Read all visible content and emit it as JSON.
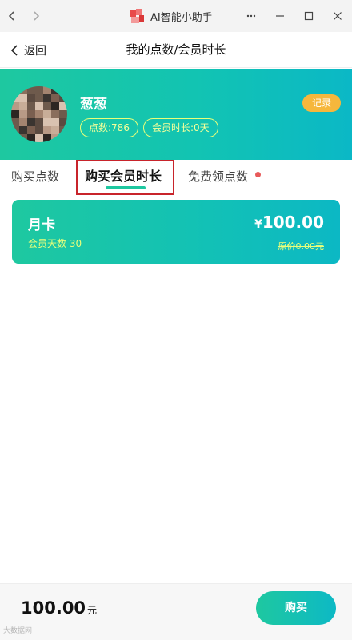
{
  "window": {
    "title": "AI智能小助手"
  },
  "header": {
    "back_label": "返回",
    "title": "我的点数/会员时长"
  },
  "profile": {
    "username": "葱葱",
    "points_chip": "点数:786",
    "membership_chip": "会员时长:0天",
    "record_button": "记录"
  },
  "tabs": [
    {
      "label": "购买点数",
      "active": false
    },
    {
      "label": "购买会员时长",
      "active": true
    },
    {
      "label": "免费领点数",
      "active": false,
      "has_dot": true
    }
  ],
  "plan_card": {
    "name": "月卡",
    "days_label": "会员天数 30",
    "currency": "¥",
    "price": "100.00",
    "original_price": "原价0.00元"
  },
  "footer": {
    "total": "100.00",
    "unit": "元",
    "buy_button": "购买"
  },
  "watermark": "大数据网",
  "colors": {
    "accent": "#1ec8a0",
    "accent_end": "#0bb8c6",
    "highlight_text": "#eaff7a",
    "record_button": "#f6b73c",
    "annotation_box": "#c8242b",
    "notification_dot": "#e85a5a"
  },
  "icons": {
    "nav_back": "chevron-left-icon",
    "nav_forward": "chevron-right-icon",
    "menu": "more-horizontal-icon",
    "minimize": "minimize-icon",
    "maximize": "maximize-icon",
    "close": "close-icon",
    "page_back": "back-arrow-icon"
  }
}
